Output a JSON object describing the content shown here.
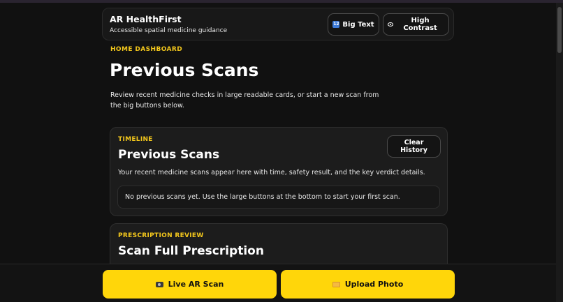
{
  "header": {
    "app_title": "AR HealthFirst",
    "app_subtitle": "Accessible spatial medicine guidance",
    "big_text_label": "Big Text",
    "high_contrast_label": "High Contrast"
  },
  "hero": {
    "eyebrow": "HOME DASHBOARD",
    "title": "Previous Scans",
    "description": "Review recent medicine checks in large readable cards, or start a new scan from the big buttons below."
  },
  "timeline_card": {
    "eyebrow": "TIMELINE",
    "title": "Previous Scans",
    "description": "Your recent medicine scans appear here with time, safety result, and the key verdict details.",
    "clear_label": "Clear History",
    "empty_message": "No previous scans yet. Use the large buttons at the bottom to start your first scan."
  },
  "prescription_card": {
    "eyebrow": "PRESCRIPTION REVIEW",
    "title": "Scan Full Prescription"
  },
  "bottom_bar": {
    "live_scan_label": "Live AR Scan",
    "upload_label": "Upload Photo"
  },
  "colors": {
    "accent": "#ffd60a",
    "eyebrow": "#f4c81c",
    "background": "#111111"
  },
  "icons": {
    "big_text": "numbers-icon",
    "high_contrast": "eye-icon",
    "live_scan": "camera-icon",
    "upload": "folder-icon"
  }
}
